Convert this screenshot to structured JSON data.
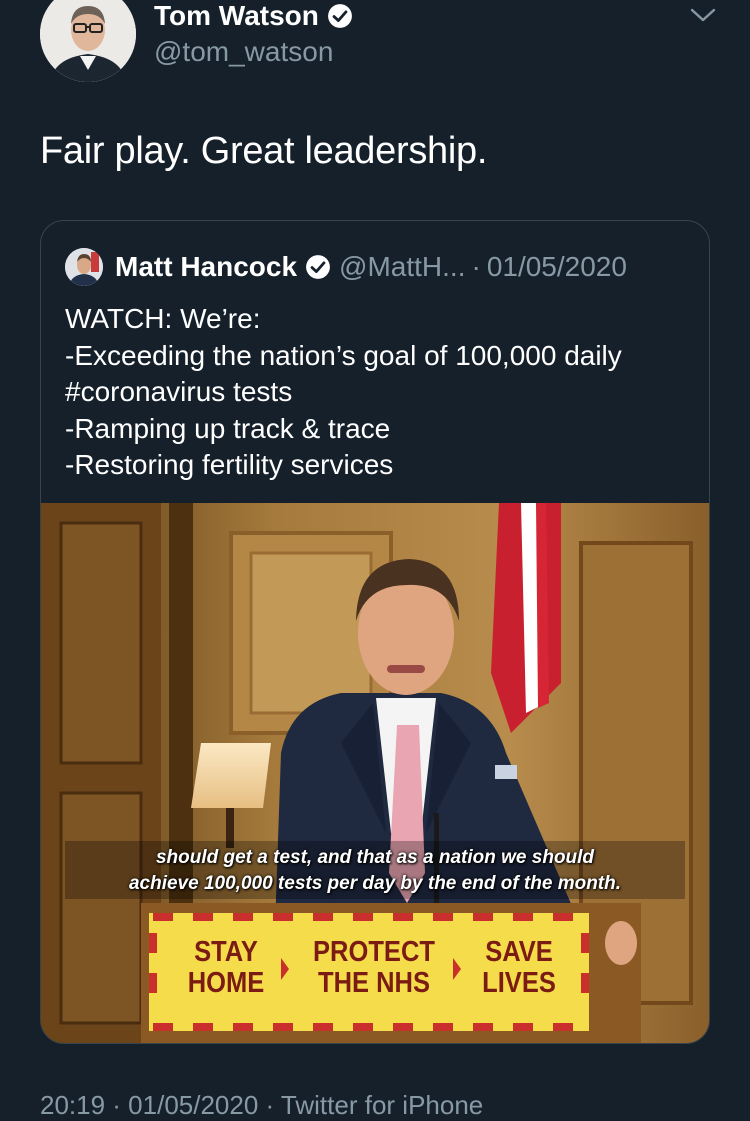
{
  "tweet": {
    "author_name": "Tom Watson",
    "author_handle": "@tom_watson",
    "text": "Fair play. Great leadership.",
    "timestamp": "20:19 · 01/05/2020 · Twitter for iPhone"
  },
  "quoted_tweet": {
    "author_name": "Matt Hancock",
    "author_handle": "@MattH...",
    "separator": "·",
    "date": "01/05/2020",
    "text_lines": [
      "WATCH: We’re:",
      "-Exceeding the nation’s goal of 100,000 daily",
      "#coronavirus tests",
      "-Ramping up track & trace",
      "-Restoring fertility services"
    ],
    "video": {
      "subtitle_line1": "should get a test, and that as a nation we should",
      "subtitle_line2": "achieve 100,000 tests per day by the end of the month.",
      "sign_col1_a": "STAY",
      "sign_col1_b": "HOME",
      "sign_col2_a": "PROTECT",
      "sign_col2_b": "THE NHS",
      "sign_col3_a": "SAVE",
      "sign_col3_b": "LIVES"
    }
  },
  "icons": {
    "verified": "verified-badge-icon",
    "menu": "chevron-down-icon"
  },
  "colors": {
    "background": "#15202b",
    "secondary_text": "#8899a6",
    "link": "#1da1f2",
    "sign_yellow": "#f5dc4a",
    "sign_red": "#c9302c"
  }
}
